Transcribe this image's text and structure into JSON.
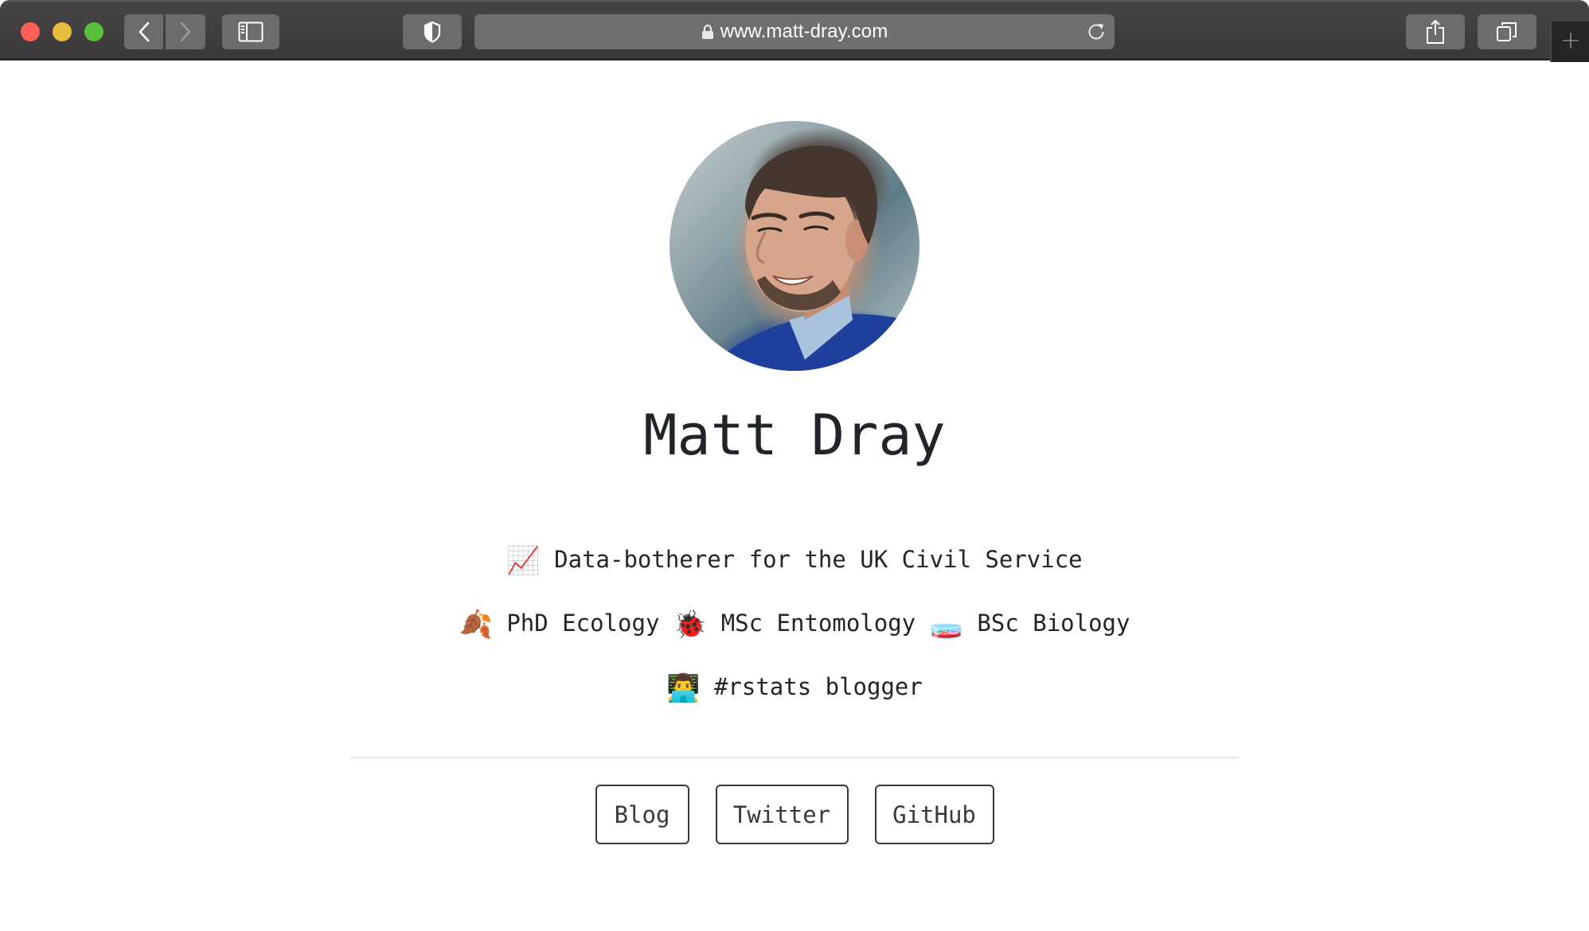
{
  "browser": {
    "url": "www.matt-dray.com",
    "icons": {
      "back": "chevron-left-icon",
      "forward": "chevron-right-icon",
      "sidebar": "sidebar-icon",
      "privacy": "shield-icon",
      "lock": "lock-icon",
      "reload": "reload-icon",
      "share": "share-icon",
      "tabs": "tabs-overview-icon",
      "new_tab": "plus-icon"
    },
    "traffic_lights": [
      "close",
      "minimize",
      "zoom"
    ]
  },
  "profile": {
    "name": "Matt Dray",
    "avatar_alt": "Photo of Matt Dray"
  },
  "bio": {
    "line1": {
      "emoji": "📈",
      "text": "Data-botherer for the UK Civil Service"
    },
    "line2": [
      {
        "emoji": "🍂",
        "text": "PhD Ecology"
      },
      {
        "emoji": "🐞",
        "text": "MSc Entomology"
      },
      {
        "emoji": "🧫",
        "text": "BSc Biology"
      }
    ],
    "line3": {
      "emoji": "👨‍💻",
      "text": "#rstats blogger"
    }
  },
  "links": [
    {
      "label": "Blog"
    },
    {
      "label": "Twitter"
    },
    {
      "label": "GitHub"
    }
  ],
  "colors": {
    "text": "#212529",
    "button_border": "#343a40",
    "divider": "#e6e6e6",
    "toolbar": "#3d3b3c"
  }
}
